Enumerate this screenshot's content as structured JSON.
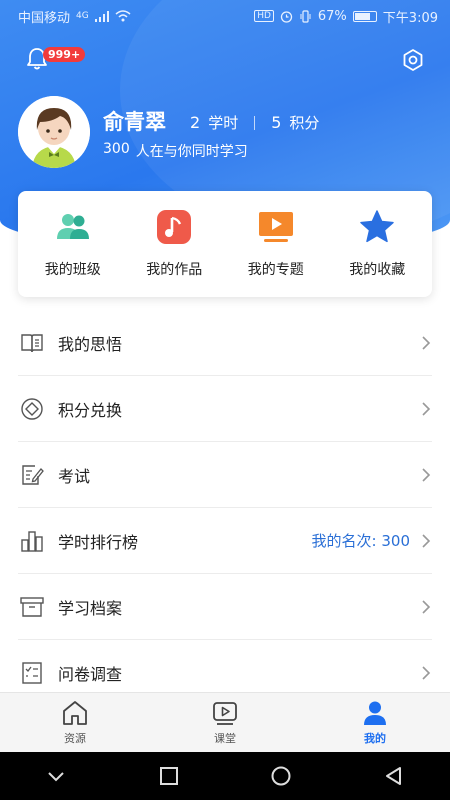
{
  "status_bar": {
    "carrier": "中国移动",
    "network": "4G",
    "battery": "67%",
    "time": "下午3:09",
    "hd_label": "HD"
  },
  "header": {
    "notification_badge": "999+",
    "user_name": "俞青翠",
    "study_hours_value": "2",
    "study_hours_label": "学时",
    "points_value": "5",
    "points_label": "积分",
    "online_count": "300",
    "online_text": "人在与你同时学习"
  },
  "quick_links": [
    {
      "label": "我的班级",
      "icon": "class-icon"
    },
    {
      "label": "我的作品",
      "icon": "music-note-icon"
    },
    {
      "label": "我的专题",
      "icon": "video-play-icon"
    },
    {
      "label": "我的收藏",
      "icon": "star-icon"
    }
  ],
  "menu": [
    {
      "label": "我的思悟",
      "icon": "book-icon",
      "extra": ""
    },
    {
      "label": "积分兑换",
      "icon": "exchange-icon",
      "extra": ""
    },
    {
      "label": "考试",
      "icon": "exam-icon",
      "extra": ""
    },
    {
      "label": "学时排行榜",
      "icon": "ranking-icon",
      "extra": "我的名次: 300"
    },
    {
      "label": "学习档案",
      "icon": "archive-icon",
      "extra": ""
    },
    {
      "label": "问卷调查",
      "icon": "survey-icon",
      "extra": ""
    }
  ],
  "tabs": [
    {
      "label": "资源",
      "icon": "home-icon",
      "active": false
    },
    {
      "label": "课堂",
      "icon": "classroom-icon",
      "active": false
    },
    {
      "label": "我的",
      "icon": "profile-icon",
      "active": true
    }
  ],
  "colors": {
    "accent": "#2a78ee",
    "badge": "#f23b3b",
    "active_tab": "#1e6ff0",
    "rank_text": "#2a6fd6"
  }
}
